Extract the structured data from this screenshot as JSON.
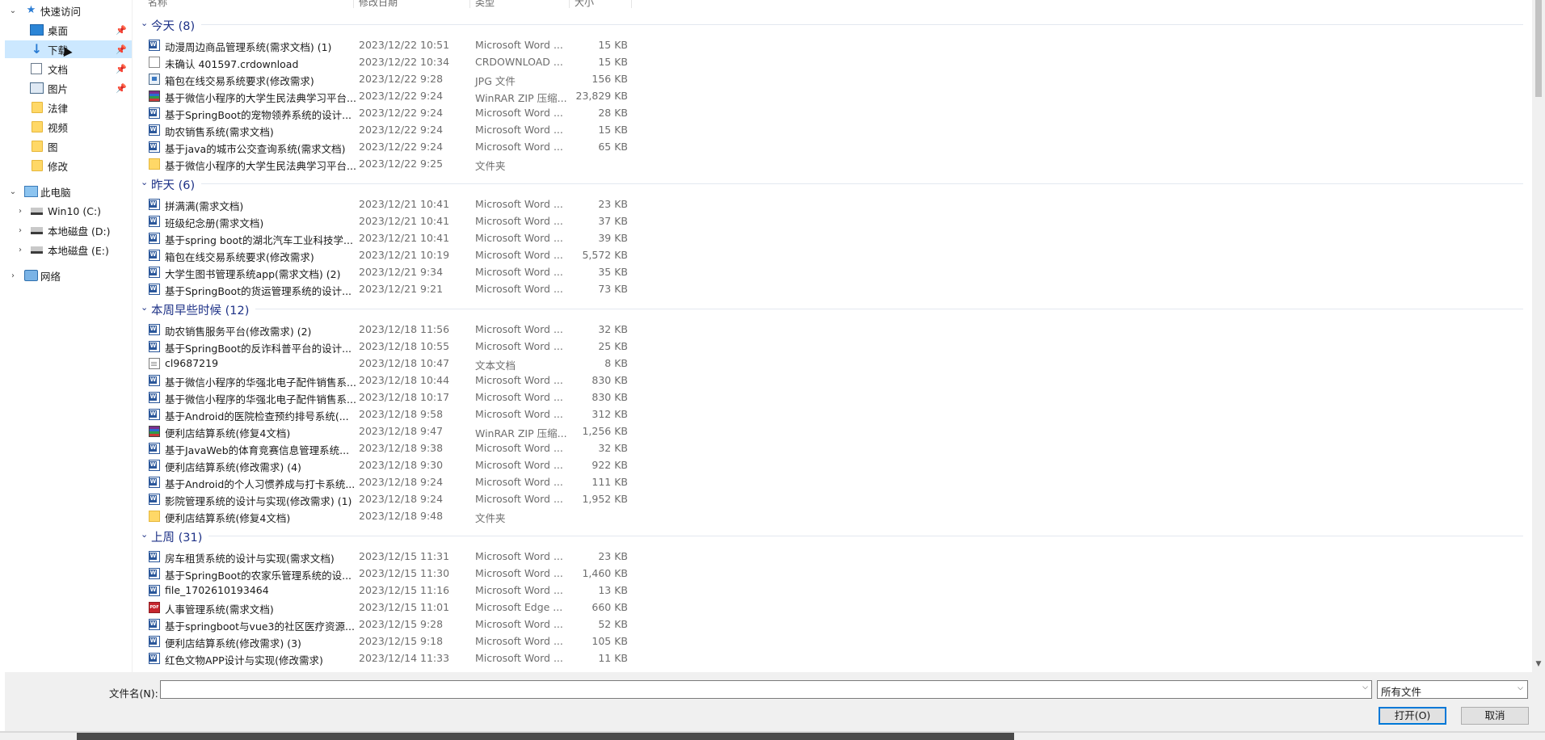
{
  "columns": {
    "name": "名称",
    "date": "修改日期",
    "type": "类型",
    "size": "大小"
  },
  "nav": {
    "items": [
      {
        "label": "快速访问",
        "pinned": false
      },
      {
        "label": "桌面",
        "pinned": true
      },
      {
        "label": "下载",
        "pinned": true
      },
      {
        "label": "文档",
        "pinned": true
      },
      {
        "label": "图片",
        "pinned": true
      },
      {
        "label": "法律",
        "pinned": false
      },
      {
        "label": "视频",
        "pinned": false
      },
      {
        "label": "图",
        "pinned": false
      },
      {
        "label": "修改",
        "pinned": false
      },
      {
        "label": "此电脑",
        "pinned": false
      },
      {
        "label": "Win10 (C:)",
        "pinned": false
      },
      {
        "label": "本地磁盘 (D:)",
        "pinned": false
      },
      {
        "label": "本地磁盘 (E:)",
        "pinned": false
      },
      {
        "label": "网络",
        "pinned": false
      }
    ],
    "selected": "下载",
    "pin_glyph": "📌"
  },
  "groups": [
    {
      "title": "今天 (8)",
      "files": [
        {
          "icon": "word-icon",
          "name": "动漫周边商品管理系统(需求文档) (1)",
          "date": "2023/12/22 10:51",
          "type": "Microsoft Word ...",
          "size": "15 KB"
        },
        {
          "icon": "blank-file-icon",
          "name": "未确认 401597.crdownload",
          "date": "2023/12/22 10:34",
          "type": "CRDOWNLOAD ...",
          "size": "15 KB"
        },
        {
          "icon": "image-icon",
          "name": "箱包在线交易系统要求(修改需求)",
          "date": "2023/12/22 9:28",
          "type": "JPG 文件",
          "size": "156 KB"
        },
        {
          "icon": "rar-icon",
          "name": "基于微信小程序的大学生民法典学习平台...",
          "date": "2023/12/22 9:24",
          "type": "WinRAR ZIP 压缩...",
          "size": "23,829 KB"
        },
        {
          "icon": "word-icon",
          "name": "基于SpringBoot的宠物领养系统的设计...",
          "date": "2023/12/22 9:24",
          "type": "Microsoft Word ...",
          "size": "28 KB"
        },
        {
          "icon": "word-icon",
          "name": "助农销售系统(需求文档)",
          "date": "2023/12/22 9:24",
          "type": "Microsoft Word ...",
          "size": "15 KB"
        },
        {
          "icon": "word-icon",
          "name": "基于java的城市公交查询系统(需求文档)",
          "date": "2023/12/22 9:24",
          "type": "Microsoft Word ...",
          "size": "65 KB"
        },
        {
          "icon": "folder-icon",
          "name": "基于微信小程序的大学生民法典学习平台...",
          "date": "2023/12/22 9:25",
          "type": "文件夹",
          "size": ""
        }
      ]
    },
    {
      "title": "昨天 (6)",
      "files": [
        {
          "icon": "word-icon",
          "name": "拼满满(需求文档)",
          "date": "2023/12/21 10:41",
          "type": "Microsoft Word ...",
          "size": "23 KB"
        },
        {
          "icon": "word-icon",
          "name": "班级纪念册(需求文档)",
          "date": "2023/12/21 10:41",
          "type": "Microsoft Word ...",
          "size": "37 KB"
        },
        {
          "icon": "word-icon",
          "name": "基于spring boot的湖北汽车工业科技学...",
          "date": "2023/12/21 10:41",
          "type": "Microsoft Word ...",
          "size": "39 KB"
        },
        {
          "icon": "word-icon",
          "name": "箱包在线交易系统要求(修改需求)",
          "date": "2023/12/21 10:19",
          "type": "Microsoft Word ...",
          "size": "5,572 KB"
        },
        {
          "icon": "word-icon",
          "name": "大学生图书管理系统app(需求文档) (2)",
          "date": "2023/12/21 9:34",
          "type": "Microsoft Word ...",
          "size": "35 KB"
        },
        {
          "icon": "word-icon",
          "name": "基于SpringBoot的货运管理系统的设计...",
          "date": "2023/12/21 9:21",
          "type": "Microsoft Word ...",
          "size": "73 KB"
        }
      ]
    },
    {
      "title": "本周早些时候 (12)",
      "files": [
        {
          "icon": "word-icon",
          "name": "助农销售服务平台(修改需求) (2)",
          "date": "2023/12/18 11:56",
          "type": "Microsoft Word ...",
          "size": "32 KB"
        },
        {
          "icon": "word-icon",
          "name": "基于SpringBoot的反诈科普平台的设计...",
          "date": "2023/12/18 10:55",
          "type": "Microsoft Word ...",
          "size": "25 KB"
        },
        {
          "icon": "text-file-icon",
          "name": "cl9687219",
          "date": "2023/12/18 10:47",
          "type": "文本文档",
          "size": "8 KB"
        },
        {
          "icon": "word-icon",
          "name": "基于微信小程序的华强北电子配件销售系...",
          "date": "2023/12/18 10:44",
          "type": "Microsoft Word ...",
          "size": "830 KB"
        },
        {
          "icon": "word-icon",
          "name": "基于微信小程序的华强北电子配件销售系...",
          "date": "2023/12/18 10:17",
          "type": "Microsoft Word ...",
          "size": "830 KB"
        },
        {
          "icon": "word-icon",
          "name": "基于Android的医院检查预约排号系统(...",
          "date": "2023/12/18 9:58",
          "type": "Microsoft Word ...",
          "size": "312 KB"
        },
        {
          "icon": "rar-icon",
          "name": "便利店结算系统(修复4文档)",
          "date": "2023/12/18 9:47",
          "type": "WinRAR ZIP 压缩...",
          "size": "1,256 KB"
        },
        {
          "icon": "word-icon",
          "name": "基于JavaWeb的体育竞赛信息管理系统...",
          "date": "2023/12/18 9:38",
          "type": "Microsoft Word ...",
          "size": "32 KB"
        },
        {
          "icon": "word-icon",
          "name": "便利店结算系统(修改需求) (4)",
          "date": "2023/12/18 9:30",
          "type": "Microsoft Word ...",
          "size": "922 KB"
        },
        {
          "icon": "word-icon",
          "name": "基于Android的个人习惯养成与打卡系统...",
          "date": "2023/12/18 9:24",
          "type": "Microsoft Word ...",
          "size": "111 KB"
        },
        {
          "icon": "word-icon",
          "name": "影院管理系统的设计与实现(修改需求) (1)",
          "date": "2023/12/18 9:24",
          "type": "Microsoft Word ...",
          "size": "1,952 KB"
        },
        {
          "icon": "folder-icon",
          "name": "便利店结算系统(修复4文档)",
          "date": "2023/12/18 9:48",
          "type": "文件夹",
          "size": ""
        }
      ]
    },
    {
      "title": "上周 (31)",
      "files": [
        {
          "icon": "word-icon",
          "name": "房车租赁系统的设计与实现(需求文档)",
          "date": "2023/12/15 11:31",
          "type": "Microsoft Word ...",
          "size": "23 KB"
        },
        {
          "icon": "word-icon",
          "name": "基于SpringBoot的农家乐管理系统的设...",
          "date": "2023/12/15 11:30",
          "type": "Microsoft Word ...",
          "size": "1,460 KB"
        },
        {
          "icon": "word-icon",
          "name": "file_1702610193464",
          "date": "2023/12/15 11:16",
          "type": "Microsoft Word ...",
          "size": "13 KB"
        },
        {
          "icon": "pdf-icon",
          "name": "人事管理系统(需求文档)",
          "date": "2023/12/15 11:01",
          "type": "Microsoft Edge ...",
          "size": "660 KB"
        },
        {
          "icon": "word-icon",
          "name": "基于springboot与vue3的社区医疗资源...",
          "date": "2023/12/15 9:28",
          "type": "Microsoft Word ...",
          "size": "52 KB"
        },
        {
          "icon": "word-icon",
          "name": "便利店结算系统(修改需求) (3)",
          "date": "2023/12/15 9:18",
          "type": "Microsoft Word ...",
          "size": "105 KB"
        },
        {
          "icon": "word-icon",
          "name": "红色文物APP设计与实现(修改需求)",
          "date": "2023/12/14 11:33",
          "type": "Microsoft Word ...",
          "size": "11 KB"
        }
      ]
    }
  ],
  "bottom": {
    "filename_label": "文件名(N):",
    "filename_value": "",
    "filter_value": "所有文件",
    "open_label": "打开(O)",
    "cancel_label": "取消"
  }
}
